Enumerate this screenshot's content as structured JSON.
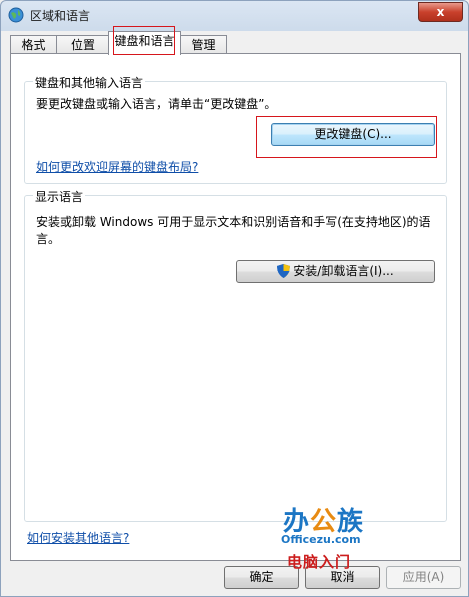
{
  "window": {
    "title": "区域和语言",
    "close_label": "x"
  },
  "tabs": [
    "格式",
    "位置",
    "键盘和语言",
    "管理"
  ],
  "active_tab": 2,
  "keyboard_group": {
    "title": "键盘和其他输入语言",
    "description": "要更改键盘或输入语言，请单击“更改键盘”。",
    "change_keyboard_button": "更改键盘(C)...",
    "link": "如何更改欢迎屏幕的键盘布局?"
  },
  "display_group": {
    "title": "显示语言",
    "description_line1": "安装或卸载 Windows 可用于显示文本和识别语音和手写(在支持地区)的语",
    "description_line2": "言。",
    "install_button": "安装/卸载语言(I)..."
  },
  "footer_link": "如何安装其他语言?",
  "buttons": {
    "ok": "确定",
    "cancel": "取消",
    "apply": "应用(A)"
  },
  "watermark": {
    "brand_part1": "办",
    "brand_part2": "公",
    "brand_part3": "族",
    "url": "Officezu.com",
    "subtitle": "电脑入门"
  },
  "colors": {
    "highlight_box": "#d6161c",
    "link": "#0f4ea8",
    "panel": "#ffffff"
  }
}
